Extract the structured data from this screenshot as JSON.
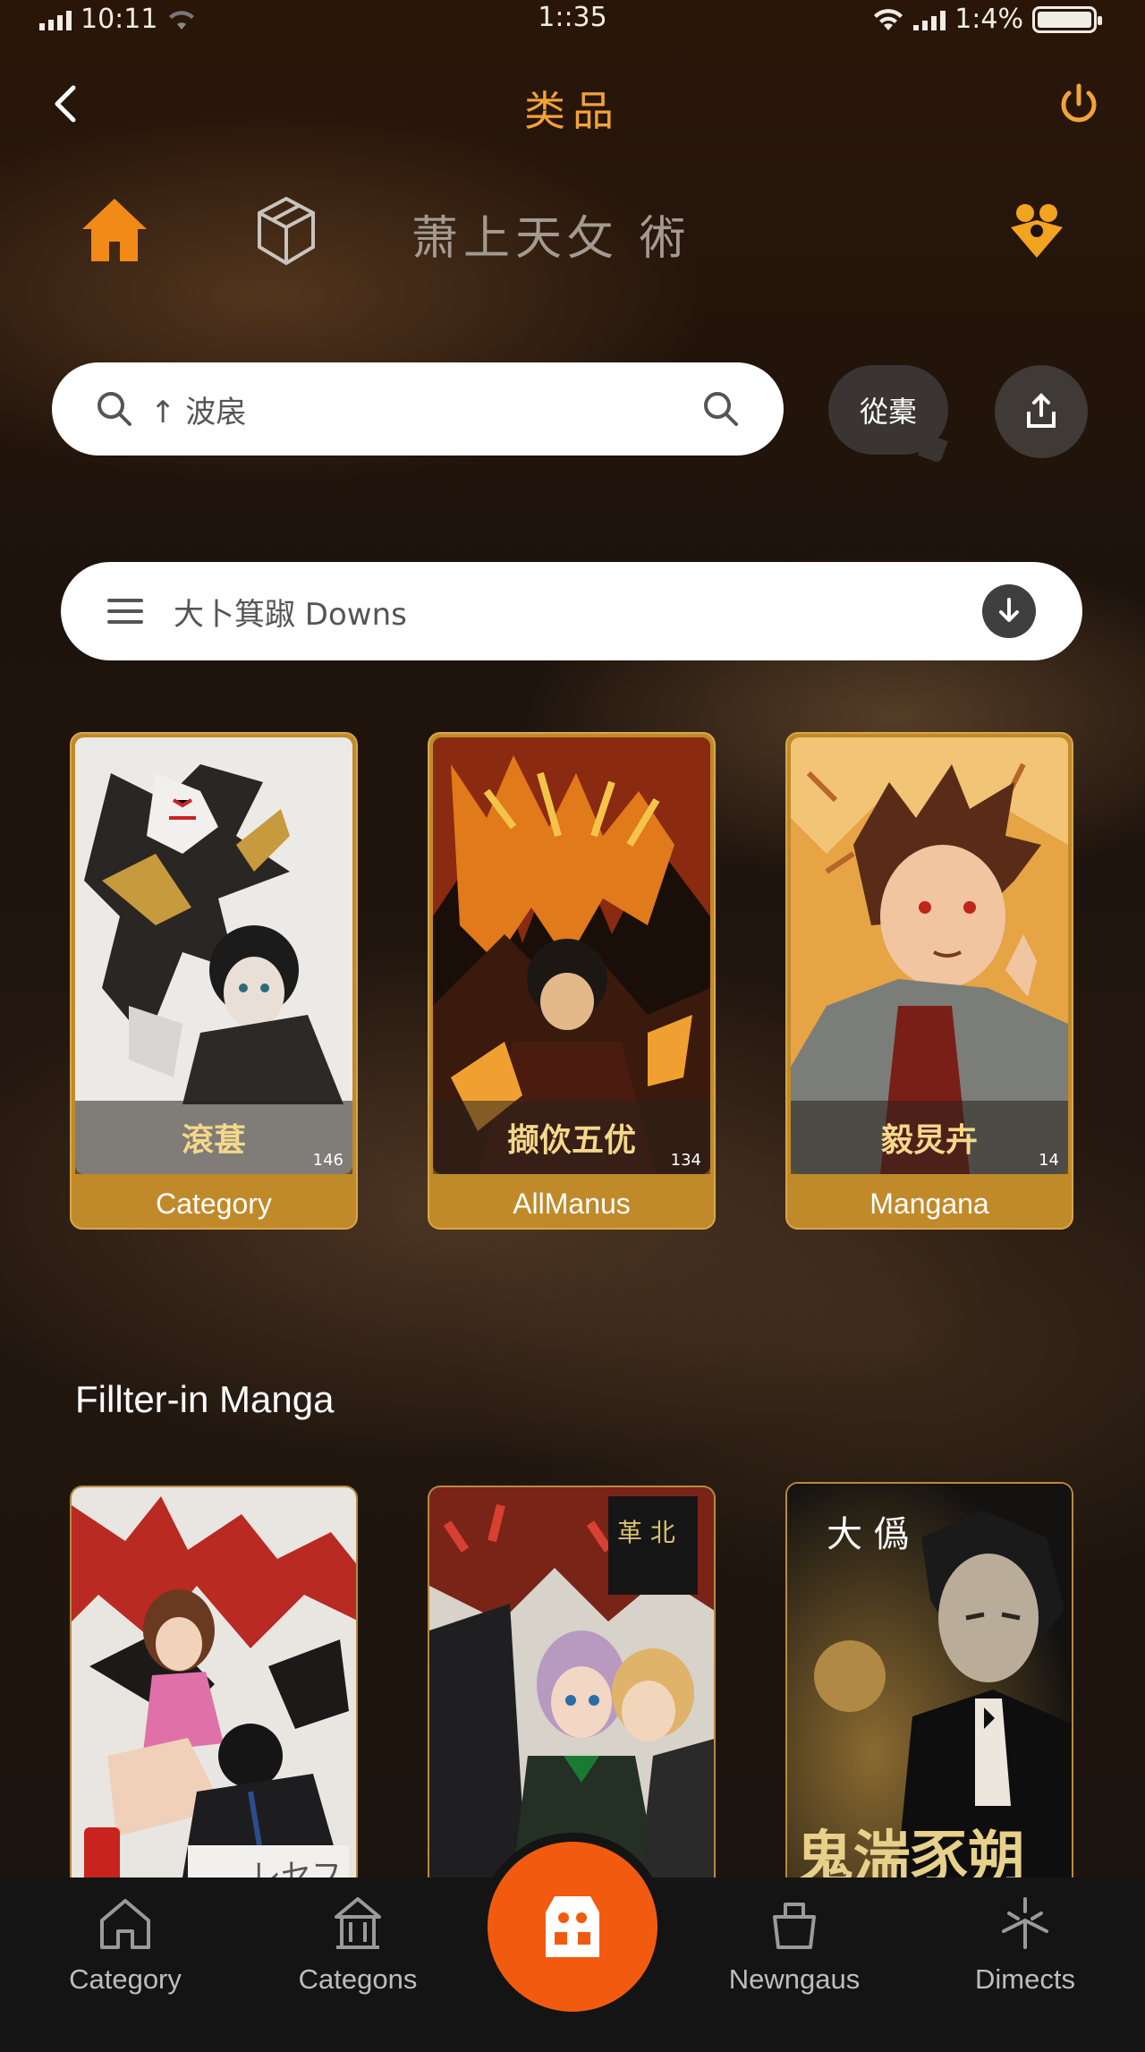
{
  "status_bar": {
    "time_left": "10:11",
    "time_center": "1::35",
    "battery": "1:4%"
  },
  "header": {
    "title": "类品",
    "back_icon": "chevron-left-icon",
    "power_icon": "power-icon"
  },
  "top_nav": {
    "text": "萧上天攵 術",
    "home_icon": "home-icon",
    "cube_icon": "cube-icon",
    "group_icon": "group-icon"
  },
  "search": {
    "value": "↑ 波扆",
    "chat_label": "從橐",
    "share_icon": "share-icon"
  },
  "dropdown": {
    "value": "大卜箕踧 Downs",
    "menu_icon": "menu-icon",
    "download_icon": "download-icon"
  },
  "categories": [
    {
      "overlay": "滾葚",
      "count": "146",
      "label": "Category"
    },
    {
      "overlay": "撷佽五优",
      "count": "134",
      "label": "AllManus"
    },
    {
      "overlay": "毅炅卉",
      "count": "14",
      "label": "Mangana"
    }
  ],
  "section": {
    "title": "Fillter-in Manga"
  },
  "manga": [
    {
      "caption": "レセフ"
    },
    {
      "caption": "革 北"
    },
    {
      "caption": "大 僞",
      "big_text": "鬼湍豕朔"
    }
  ],
  "bottom_nav": {
    "tabs": [
      "Category",
      "Categons",
      "Newngaus",
      "Dimects"
    ],
    "fab_icon": "store-icon",
    "accent": "#f25a10"
  },
  "colors": {
    "accent": "#f2a33a",
    "card": "#c08a2a"
  }
}
